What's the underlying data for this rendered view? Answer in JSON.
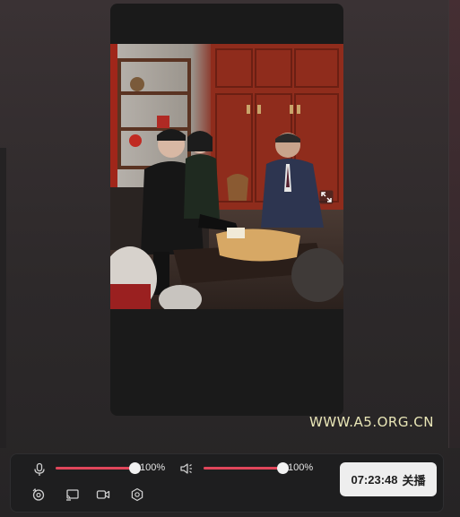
{
  "watermark": "WWW.A5.ORG.CN",
  "controls": {
    "mic": {
      "icon": "microphone-icon",
      "volume_percent": 100,
      "label": "100%"
    },
    "speaker": {
      "icon": "speaker-volume-icon",
      "volume_percent": 100,
      "label": "100%"
    },
    "bottom_icons": [
      "camera-rotate-icon",
      "screen-share-icon",
      "video-camera-icon",
      "settings-gear-icon"
    ],
    "live_button": {
      "time": "07:23:48",
      "action": "关播"
    }
  },
  "video": {
    "expand_icon": "fullscreen-expand-icon"
  },
  "colors": {
    "accent": "#e0465a",
    "background": "#2d292a",
    "panel": "#1e1e1f",
    "watermark": "#e9e6b7"
  }
}
